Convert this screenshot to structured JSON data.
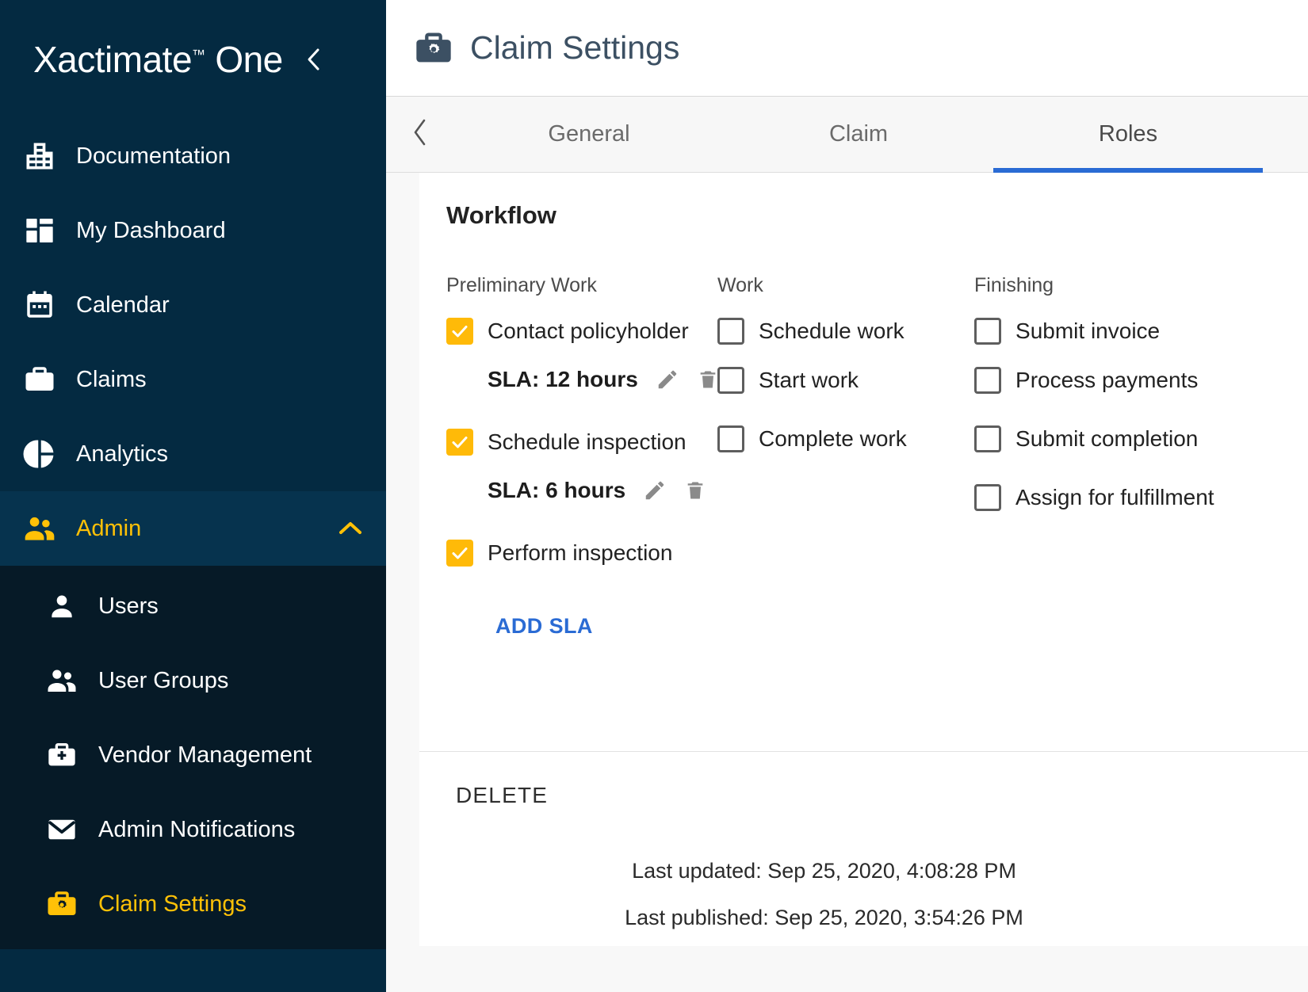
{
  "sidebar": {
    "brand": {
      "name": "Xactimate",
      "tm": "™",
      "suffix": "One"
    },
    "collapse_icon": "chevron-left-icon",
    "items": [
      {
        "label": "Documentation",
        "icon": "building-icon"
      },
      {
        "label": "My Dashboard",
        "icon": "dashboard-icon"
      },
      {
        "label": "Calendar",
        "icon": "calendar-icon"
      },
      {
        "label": "Claims",
        "icon": "briefcase-icon"
      },
      {
        "label": "Analytics",
        "icon": "pie-chart-icon"
      },
      {
        "label": "Admin",
        "icon": "people-icon",
        "expanded": true,
        "chevron": "chevron-up-icon"
      }
    ],
    "submenu": [
      {
        "label": "Users",
        "icon": "person-icon"
      },
      {
        "label": "User Groups",
        "icon": "people-icon"
      },
      {
        "label": "Vendor Management",
        "icon": "briefcase-plus-icon"
      },
      {
        "label": "Admin Notifications",
        "icon": "envelope-icon"
      },
      {
        "label": "Claim Settings",
        "icon": "briefcase-gear-icon",
        "selected": true
      }
    ],
    "colors": {
      "background": "#042a41",
      "submenu_background": "#061a27",
      "accent": "#ffc107"
    }
  },
  "header": {
    "title": "Claim Settings",
    "icon": "briefcase-gear-icon"
  },
  "tabs": {
    "back_icon": "chevron-left-icon",
    "items": [
      {
        "label": "General",
        "active": false
      },
      {
        "label": "Claim",
        "active": false
      },
      {
        "label": "Roles",
        "active": true
      }
    ],
    "active_color": "#2a6bd4"
  },
  "workflow": {
    "title": "Workflow",
    "columns": [
      {
        "heading": "Preliminary Work",
        "tasks": [
          {
            "label": "Contact policyholder",
            "checked": true,
            "sla": "SLA: 12 hours",
            "edit_icon": "pencil-icon",
            "delete_icon": "trash-icon"
          },
          {
            "label": "Schedule inspection",
            "checked": true,
            "sla": "SLA: 6 hours",
            "edit_icon": "pencil-icon",
            "delete_icon": "trash-icon"
          },
          {
            "label": "Perform inspection",
            "checked": true,
            "add_sla_label": "ADD SLA"
          }
        ]
      },
      {
        "heading": "Work",
        "tasks": [
          {
            "label": "Schedule work",
            "checked": false
          },
          {
            "label": "Start work",
            "checked": false
          },
          {
            "label": "Complete work",
            "checked": false
          }
        ]
      },
      {
        "heading": "Finishing",
        "tasks": [
          {
            "label": "Submit invoice",
            "checked": false
          },
          {
            "label": "Process payments",
            "checked": false
          },
          {
            "label": "Submit completion",
            "checked": false
          },
          {
            "label": "Assign for fulfillment",
            "checked": false
          }
        ]
      }
    ],
    "delete_label": "DELETE",
    "checkbox_checked_color": "#ffba08"
  },
  "footer": {
    "last_updated": "Last updated: Sep 25, 2020, 4:08:28 PM",
    "last_published": "Last published: Sep 25, 2020, 3:54:26 PM"
  }
}
